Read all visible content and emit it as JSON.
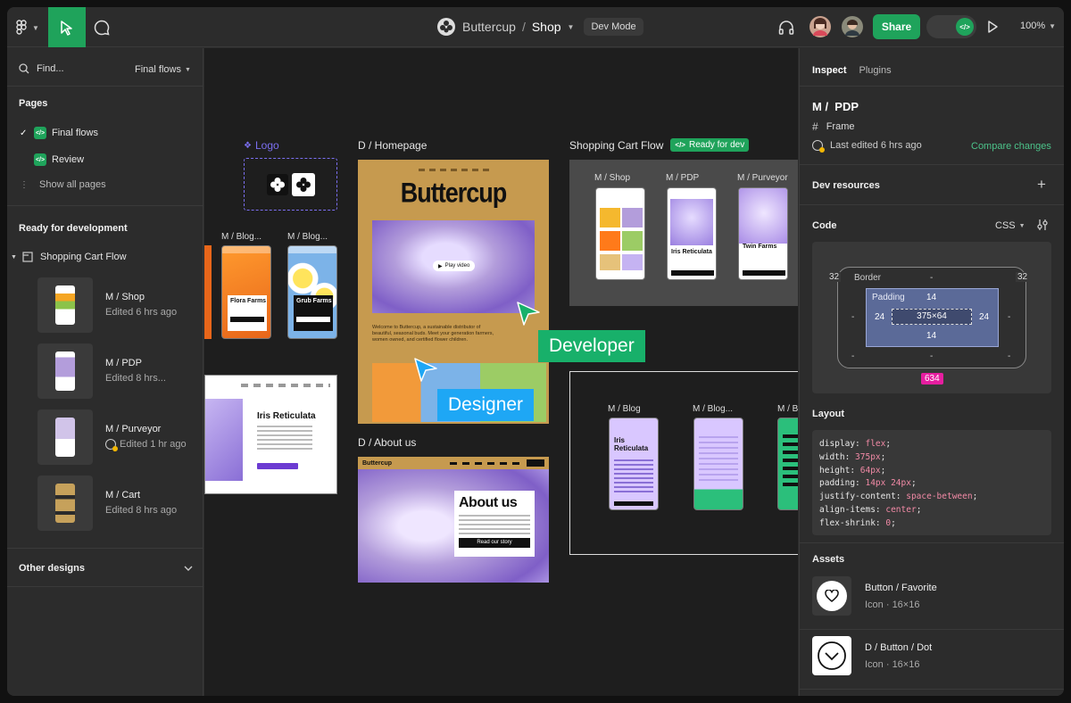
{
  "topbar": {
    "project": "Buttercup",
    "separator": "/",
    "file": "Shop",
    "dev_mode": "Dev Mode",
    "share": "Share",
    "zoom": "100%"
  },
  "left": {
    "find_placeholder": "Find...",
    "page_filter": "Final flows",
    "pages_title": "Pages",
    "pages": [
      {
        "label": "Final flows"
      },
      {
        "label": "Review"
      }
    ],
    "show_all": "Show all pages",
    "ready_title": "Ready for development",
    "flow_name": "Shopping Cart Flow",
    "frames": [
      {
        "title": "M / Shop",
        "sub": "Edited 6 hrs ago"
      },
      {
        "title": "M / PDP",
        "sub": "Edited 8 hrs..."
      },
      {
        "title": "M / Purveyor",
        "sub": "Edited 1 hr ago"
      },
      {
        "title": "M / Cart",
        "sub": "Edited 8 hrs ago"
      }
    ],
    "other_designs": "Other designs"
  },
  "canvas": {
    "logo_label": "Logo",
    "homepage_label": "D / Homepage",
    "homepage_brand": "Buttercup",
    "play_video": "Play video",
    "homepage_blurb": "Welcome to Buttercup, a sustainable distributor of beautiful, seasonal buds. Meet your generation farmers, women owned, and certified flower children.",
    "cart_flow_label": "Shopping Cart Flow",
    "ready_badge": "Ready for dev",
    "cart_frames": [
      "M / Shop",
      "M / PDP",
      "M / Purveyor"
    ],
    "blog_labels": [
      "M / Blog...",
      "M / Blog..."
    ],
    "flora": "Flora Farms",
    "grub": "Grub Farms",
    "iris": "Iris Reticulata",
    "twin": "Twin Farms",
    "about_label": "D / About us",
    "about_title": "About us",
    "about_brand": "Buttercup",
    "about_button": "Read our story",
    "blog_frames": [
      "M / Blog",
      "M / Blog...",
      "M / B"
    ],
    "developer": "Developer",
    "designer": "Designer"
  },
  "right": {
    "tab_inspect": "Inspect",
    "tab_plugins": "Plugins",
    "frame_title": "M /  PDP",
    "frame_type": "Frame",
    "last_edited": "Last edited 6 hrs ago",
    "compare": "Compare changes",
    "dev_resources": "Dev resources",
    "code_title": "Code",
    "code_lang": "CSS",
    "box": {
      "border": "Border",
      "border_l": "32",
      "border_r": "32",
      "padding": "Padding",
      "pad_t": "14",
      "pad_b": "14",
      "pad_l": "24",
      "pad_r": "24",
      "size": "375×64",
      "dash": "-",
      "badge": "634"
    },
    "layout_title": "Layout",
    "code_lines": [
      {
        "prop": "display: ",
        "val": "flex",
        "end": ";"
      },
      {
        "prop": "width: ",
        "val": "375px",
        "end": ";"
      },
      {
        "prop": "height: ",
        "val": "64px",
        "end": ";"
      },
      {
        "prop": "padding: ",
        "val": "14px 24px",
        "end": ";"
      },
      {
        "prop": "justify-content: ",
        "val": "space-between",
        "end": ";"
      },
      {
        "prop": "align-items: ",
        "val": "center",
        "end": ";"
      },
      {
        "prop": "flex-shrink: ",
        "val": "0",
        "end": ";"
      }
    ],
    "assets_title": "Assets",
    "assets": [
      {
        "name": "Button / Favorite",
        "meta": "Icon · 16×16"
      },
      {
        "name": "D / Button / Dot",
        "meta": "Icon · 16×16"
      }
    ]
  },
  "colors": {
    "accent": "#1fa35b",
    "designer": "#1ea7f5",
    "developer": "#18b06a",
    "badge": "#e61ea0",
    "logo_label": "#7b6ff0"
  }
}
